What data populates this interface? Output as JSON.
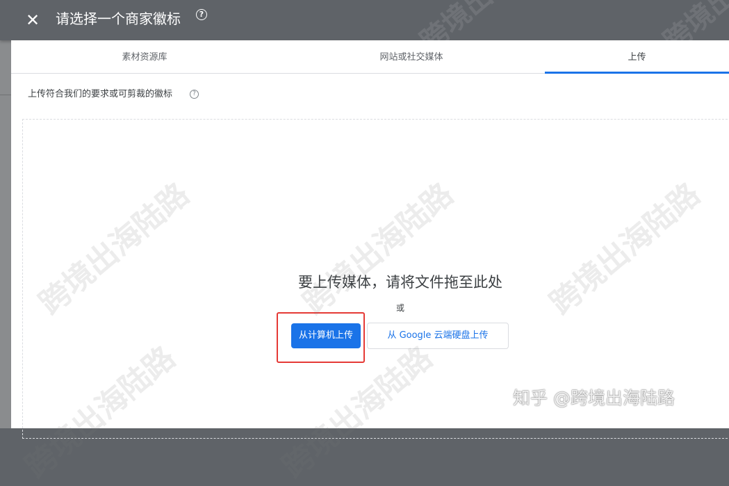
{
  "dialog": {
    "title": "请选择一个商家徽标",
    "close_icon": "close-icon",
    "help_icon": "help-icon",
    "help_glyph": "?"
  },
  "tabs": [
    {
      "label": "素材资源库",
      "active": false
    },
    {
      "label": "网站或社交媒体",
      "active": false
    },
    {
      "label": "上传",
      "active": true
    }
  ],
  "upload": {
    "instruction": "上传符合我们的要求或可剪裁的徽标",
    "instruction_help_glyph": "?",
    "drop_heading": "要上传媒体，请将文件拖至此处",
    "or_text": "或",
    "upload_computer_label": "从计算机上传",
    "upload_drive_label": "从 Google 云端硬盘上传"
  },
  "watermarks": {
    "text": "跨境出海陆路",
    "zhihu": "知乎 @跨境出海陆路"
  },
  "colors": {
    "header_bg": "#5f6368",
    "accent": "#1a73e8",
    "highlight": "#e53935"
  }
}
